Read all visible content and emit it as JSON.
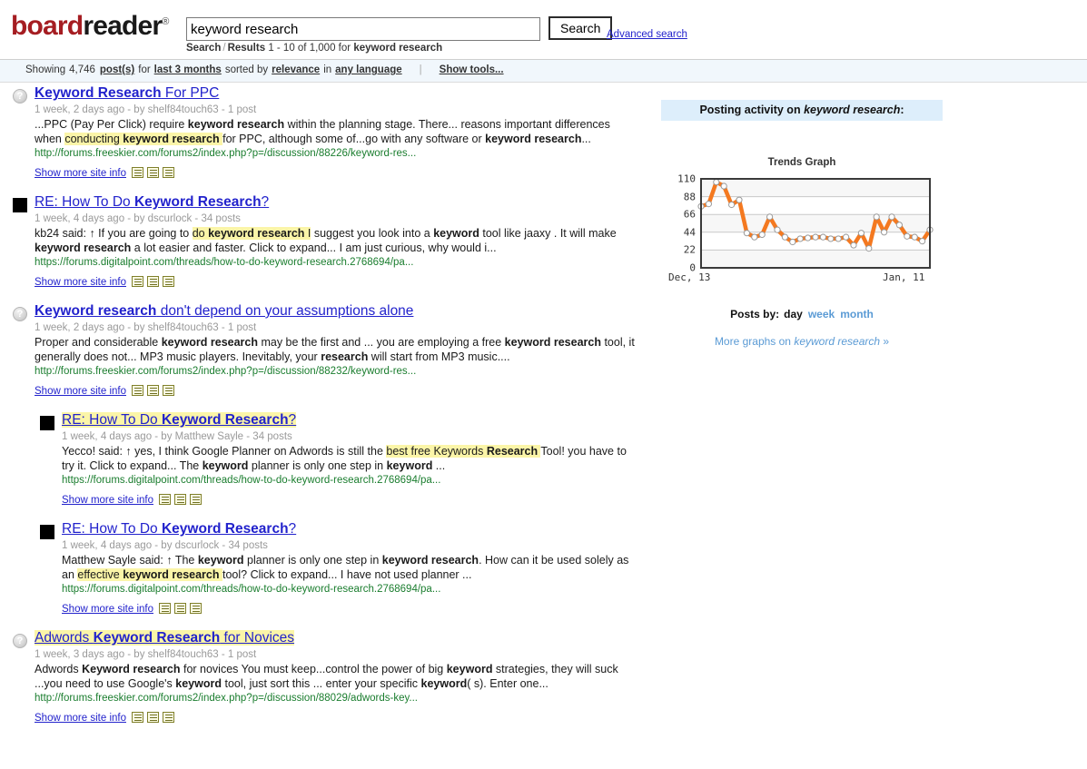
{
  "header": {
    "logo_board": "board",
    "logo_reader": "reader",
    "logo_reg": "®",
    "search_value": "keyword research",
    "search_placeholder": "",
    "search_button": "Search",
    "advanced_search": "Advanced search",
    "breadcrumb_search": "Search",
    "breadcrumb_sep": "/",
    "breadcrumb_results_label": "Results",
    "breadcrumb_range": "1 - 10 of 1,000 for",
    "breadcrumb_query": "keyword research"
  },
  "filterbar": {
    "showing": "Showing",
    "count": "4,746",
    "posts": "post(s)",
    "for": "for",
    "timeframe": "last 3 months",
    "sorted_by": "sorted by",
    "sort": "relevance",
    "in": "in",
    "language": "any language",
    "pipe": "|",
    "show_tools": "Show tools..."
  },
  "results": [
    {
      "favicon": "question-circle",
      "indent": false,
      "title_parts": [
        {
          "text": "Keyword Research",
          "bold": true,
          "hl": false
        },
        {
          "text": " For PPC",
          "bold": false,
          "hl": false
        }
      ],
      "meta": "1 week, 2 days ago - by shelf84touch63 - 1 post",
      "snippet_parts": [
        {
          "text": "...PPC (Pay Per Click) require ",
          "bold": false,
          "hl": false
        },
        {
          "text": "keyword research",
          "bold": true,
          "hl": false
        },
        {
          "text": " within the planning stage. There... reasons important differences when ",
          "bold": false,
          "hl": false
        },
        {
          "text": "conducting ",
          "bold": false,
          "hl": true
        },
        {
          "text": "keyword research",
          "bold": true,
          "hl": true
        },
        {
          "text": " ",
          "bold": false,
          "hl": true
        },
        {
          "text": "for PPC, although some of...go with any software or ",
          "bold": false,
          "hl": false
        },
        {
          "text": "keyword research",
          "bold": true,
          "hl": false
        },
        {
          "text": "...",
          "bold": false,
          "hl": false
        }
      ],
      "url": "http://forums.freeskier.com/forums2/index.php?p=/discussion/88226/keyword-res...",
      "more_info": "Show more site info"
    },
    {
      "favicon": "black-square",
      "indent": false,
      "title_parts": [
        {
          "text": "RE: How To Do ",
          "bold": false,
          "hl": false
        },
        {
          "text": "Keyword Research",
          "bold": true,
          "hl": false
        },
        {
          "text": "?",
          "bold": false,
          "hl": false
        }
      ],
      "meta": "1 week, 4 days ago - by dscurlock - 34 posts",
      "snippet_parts": [
        {
          "text": "kb24 said: ↑ If you are going to ",
          "bold": false,
          "hl": false
        },
        {
          "text": "do ",
          "bold": false,
          "hl": true
        },
        {
          "text": "keyword research",
          "bold": true,
          "hl": true
        },
        {
          "text": " I",
          "bold": false,
          "hl": true
        },
        {
          "text": " suggest you look into a ",
          "bold": false,
          "hl": false
        },
        {
          "text": "keyword",
          "bold": true,
          "hl": false
        },
        {
          "text": " tool like jaaxy . It will make ",
          "bold": false,
          "hl": false
        },
        {
          "text": "keyword research",
          "bold": true,
          "hl": false
        },
        {
          "text": " a lot easier and faster. Click to expand... I am just curious, why would i...",
          "bold": false,
          "hl": false
        }
      ],
      "url": "https://forums.digitalpoint.com/threads/how-to-do-keyword-research.2768694/pa...",
      "more_info": "Show more site info"
    },
    {
      "favicon": "question-circle",
      "indent": false,
      "title_parts": [
        {
          "text": "Keyword research",
          "bold": true,
          "hl": false
        },
        {
          "text": " don't depend on your assumptions alone",
          "bold": false,
          "hl": false
        }
      ],
      "meta": "1 week, 2 days ago - by shelf84touch63 - 1 post",
      "snippet_parts": [
        {
          "text": "Proper and considerable ",
          "bold": false,
          "hl": false
        },
        {
          "text": "keyword research",
          "bold": true,
          "hl": false
        },
        {
          "text": " may be the first and ... you are employing a free ",
          "bold": false,
          "hl": false
        },
        {
          "text": "keyword research",
          "bold": true,
          "hl": false
        },
        {
          "text": " tool, it generally does not... MP3 music players. Inevitably, your ",
          "bold": false,
          "hl": false
        },
        {
          "text": "research",
          "bold": true,
          "hl": false
        },
        {
          "text": " will start from MP3 music....",
          "bold": false,
          "hl": false
        }
      ],
      "url": "http://forums.freeskier.com/forums2/index.php?p=/discussion/88232/keyword-res...",
      "more_info": "Show more site info"
    },
    {
      "favicon": "black-square",
      "indent": true,
      "title_hl": true,
      "title_parts": [
        {
          "text": "RE: How To Do ",
          "bold": false,
          "hl": true
        },
        {
          "text": "Keyword Research",
          "bold": true,
          "hl": true
        },
        {
          "text": "?",
          "bold": false,
          "hl": true
        }
      ],
      "meta": "1 week, 4 days ago - by Matthew Sayle - 34 posts",
      "snippet_parts": [
        {
          "text": "Yecco! said: ↑ yes, I think Google Planner on Adwords is still the ",
          "bold": false,
          "hl": false
        },
        {
          "text": "best free Keywords ",
          "bold": false,
          "hl": true
        },
        {
          "text": "Research",
          "bold": true,
          "hl": true
        },
        {
          "text": " ",
          "bold": false,
          "hl": true
        },
        {
          "text": "Tool! you have to try it. Click to expand... The ",
          "bold": false,
          "hl": false
        },
        {
          "text": "keyword",
          "bold": true,
          "hl": false
        },
        {
          "text": " planner is only one step in ",
          "bold": false,
          "hl": false
        },
        {
          "text": "keyword",
          "bold": true,
          "hl": false
        },
        {
          "text": " ...",
          "bold": false,
          "hl": false
        }
      ],
      "url": "https://forums.digitalpoint.com/threads/how-to-do-keyword-research.2768694/pa...",
      "more_info": "Show more site info"
    },
    {
      "favicon": "black-square",
      "indent": true,
      "title_parts": [
        {
          "text": "RE: How To Do ",
          "bold": false,
          "hl": false
        },
        {
          "text": "Keyword Research",
          "bold": true,
          "hl": false
        },
        {
          "text": "?",
          "bold": false,
          "hl": false
        }
      ],
      "meta": "1 week, 4 days ago - by dscurlock - 34 posts",
      "snippet_parts": [
        {
          "text": "Matthew Sayle said: ↑ The ",
          "bold": false,
          "hl": false
        },
        {
          "text": "keyword",
          "bold": true,
          "hl": false
        },
        {
          "text": " planner is only one step in ",
          "bold": false,
          "hl": false
        },
        {
          "text": "keyword research",
          "bold": true,
          "hl": false
        },
        {
          "text": ". How can it be used solely as an ",
          "bold": false,
          "hl": false
        },
        {
          "text": "effective ",
          "bold": false,
          "hl": true
        },
        {
          "text": "keyword research",
          "bold": true,
          "hl": true
        },
        {
          "text": " ",
          "bold": false,
          "hl": true
        },
        {
          "text": "tool? Click to expand... I have not used planner ...",
          "bold": false,
          "hl": false
        }
      ],
      "url": "https://forums.digitalpoint.com/threads/how-to-do-keyword-research.2768694/pa...",
      "more_info": "Show more site info"
    },
    {
      "favicon": "question-circle",
      "indent": false,
      "title_hl": true,
      "title_parts": [
        {
          "text": "Adwords ",
          "bold": false,
          "hl": false
        },
        {
          "text": "Keyword Research",
          "bold": true,
          "hl": true
        },
        {
          "text": " for Novices",
          "bold": false,
          "hl": true
        }
      ],
      "meta": "1 week, 3 days ago - by shelf84touch63 - 1 post",
      "snippet_parts": [
        {
          "text": "Adwords ",
          "bold": false,
          "hl": false
        },
        {
          "text": "Keyword research",
          "bold": true,
          "hl": false
        },
        {
          "text": " for novices You must keep...control the power of big ",
          "bold": false,
          "hl": false
        },
        {
          "text": "keyword",
          "bold": true,
          "hl": false
        },
        {
          "text": " strategies, they will suck ...you need to use Google's ",
          "bold": false,
          "hl": false
        },
        {
          "text": "keyword",
          "bold": true,
          "hl": false
        },
        {
          "text": " tool, just sort this ... enter your specific ",
          "bold": false,
          "hl": false
        },
        {
          "text": "keyword",
          "bold": true,
          "hl": false
        },
        {
          "text": "( s). Enter one...",
          "bold": false,
          "hl": false
        }
      ],
      "url": "http://forums.freeskier.com/forums2/index.php?p=/discussion/88029/adwords-key...",
      "more_info": "Show more site info"
    }
  ],
  "sidebar": {
    "panel_prefix": "Posting activity on ",
    "panel_query": "keyword research",
    "panel_suffix": ":",
    "posts_by_label": "Posts by:",
    "posts_by_current": "day",
    "posts_by_options": [
      "week",
      "month"
    ],
    "more_graphs_prefix": "More graphs on ",
    "more_graphs_query": "keyword research",
    "more_graphs_suffix": " »"
  },
  "chart_data": {
    "type": "line",
    "title": "Trends Graph",
    "xlabel": "",
    "ylabel": "",
    "ylim": [
      0,
      110
    ],
    "yticks": [
      0,
      22,
      44,
      66,
      88,
      110
    ],
    "xticks": [
      "Dec, 13",
      "Jan, 11"
    ],
    "grid": true,
    "legend": "none",
    "line_color": "#f47920",
    "marker_color": "#ffffff",
    "x_start": "Dec, 13",
    "x_end": "Jan, 11",
    "x": [
      "Dec 13",
      "Dec 14",
      "Dec 15",
      "Dec 16",
      "Dec 17",
      "Dec 18",
      "Dec 19",
      "Dec 20",
      "Dec 21",
      "Dec 22",
      "Dec 23",
      "Dec 24",
      "Dec 25",
      "Dec 26",
      "Dec 27",
      "Dec 28",
      "Dec 29",
      "Dec 30",
      "Dec 31",
      "Jan 1",
      "Jan 2",
      "Jan 3",
      "Jan 4",
      "Jan 5",
      "Jan 6",
      "Jan 7",
      "Jan 8",
      "Jan 9",
      "Jan 10",
      "Jan 11"
    ],
    "values": [
      76,
      79,
      106,
      101,
      78,
      84,
      43,
      38,
      41,
      63,
      47,
      38,
      32,
      36,
      37,
      38,
      38,
      36,
      36,
      38,
      28,
      43,
      24,
      63,
      44,
      63,
      53,
      39,
      38,
      33,
      47
    ]
  }
}
